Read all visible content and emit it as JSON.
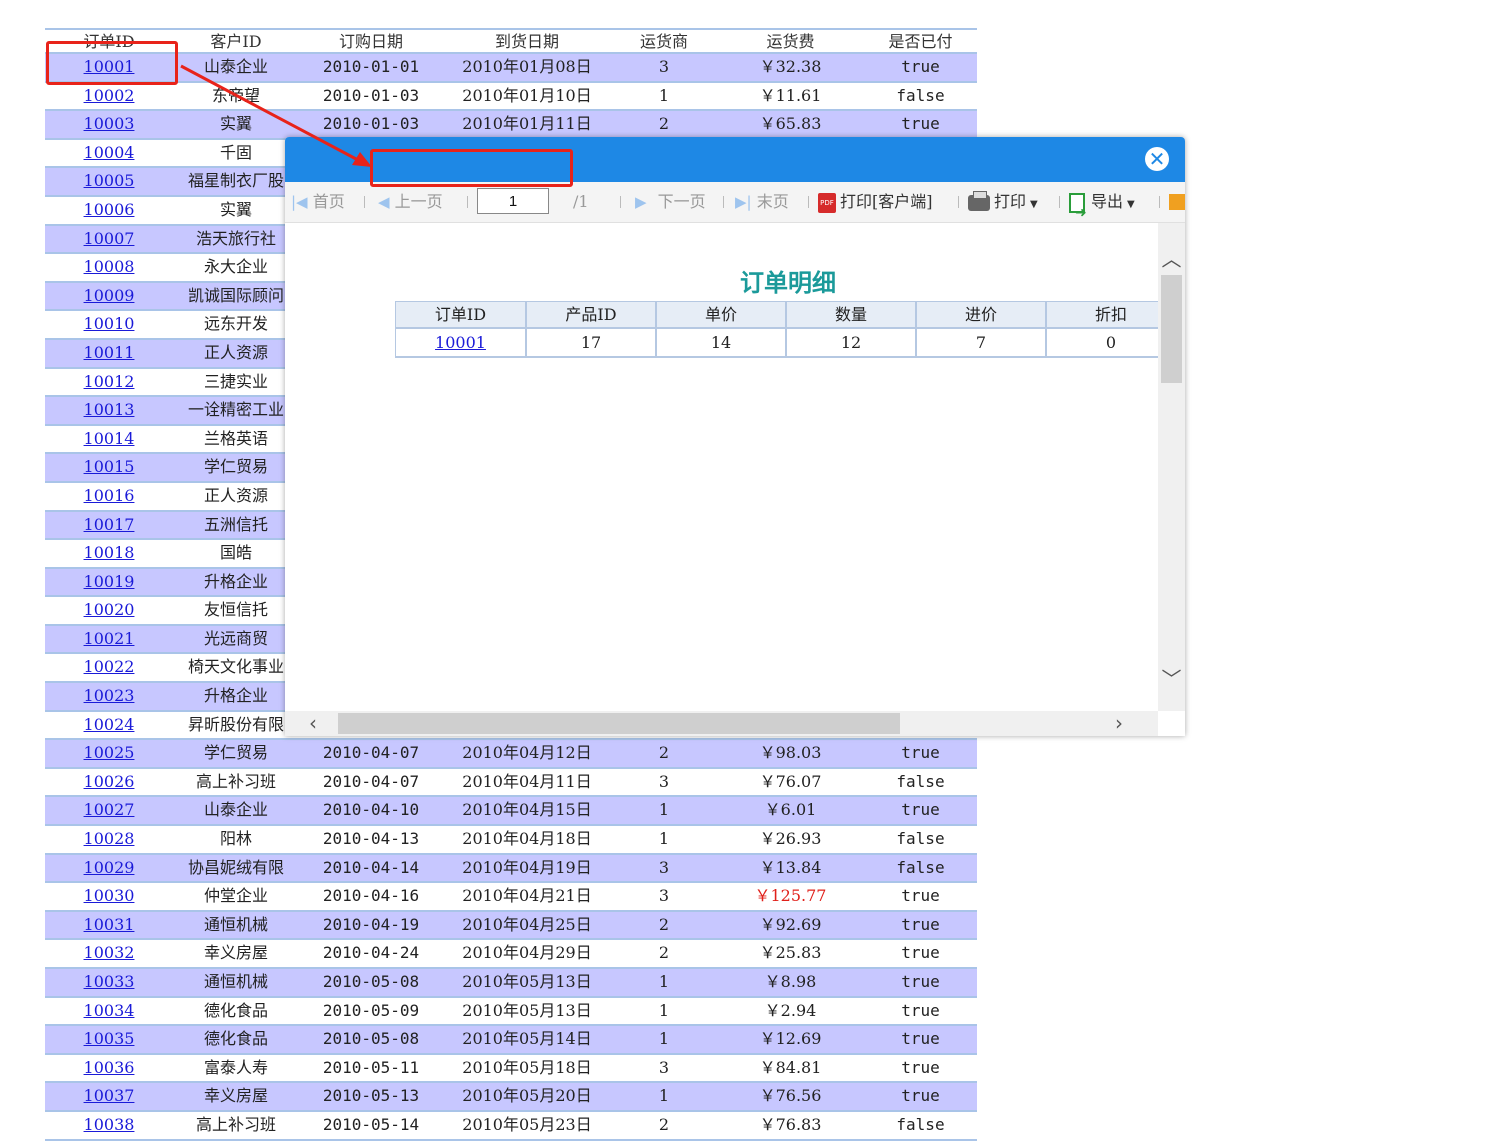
{
  "orders_table": {
    "headers": [
      "订单ID",
      "客户ID",
      "订购日期",
      "到货日期",
      "运货商",
      "运货费",
      "是否已付"
    ],
    "rows": [
      [
        "10001",
        "山泰企业",
        "2010-01-01",
        "2010年01月08日",
        "3",
        "￥32.38",
        "true"
      ],
      [
        "10002",
        "东帝望",
        "2010-01-03",
        "2010年01月10日",
        "1",
        "￥11.61",
        "false"
      ],
      [
        "10003",
        "实翼",
        "2010-01-03",
        "2010年01月11日",
        "2",
        "￥65.83",
        "true"
      ],
      [
        "10004",
        "千固",
        "",
        "",
        "",
        "",
        ""
      ],
      [
        "10005",
        "福星制衣厂股",
        "",
        "",
        "",
        "",
        ""
      ],
      [
        "10006",
        "实翼",
        "",
        "",
        "",
        "",
        ""
      ],
      [
        "10007",
        "浩天旅行社",
        "",
        "",
        "",
        "",
        ""
      ],
      [
        "10008",
        "永大企业",
        "",
        "",
        "",
        "",
        ""
      ],
      [
        "10009",
        "凯诚国际顾问",
        "",
        "",
        "",
        "",
        ""
      ],
      [
        "10010",
        "远东开发",
        "",
        "",
        "",
        "",
        ""
      ],
      [
        "10011",
        "正人资源",
        "",
        "",
        "",
        "",
        ""
      ],
      [
        "10012",
        "三捷实业",
        "",
        "",
        "",
        "",
        ""
      ],
      [
        "10013",
        "一诠精密工业",
        "",
        "",
        "",
        "",
        ""
      ],
      [
        "10014",
        "兰格英语",
        "",
        "",
        "",
        "",
        ""
      ],
      [
        "10015",
        "学仁贸易",
        "",
        "",
        "",
        "",
        ""
      ],
      [
        "10016",
        "正人资源",
        "",
        "",
        "",
        "",
        ""
      ],
      [
        "10017",
        "五洲信托",
        "",
        "",
        "",
        "",
        ""
      ],
      [
        "10018",
        "国皓",
        "",
        "",
        "",
        "",
        ""
      ],
      [
        "10019",
        "升格企业",
        "",
        "",
        "",
        "",
        ""
      ],
      [
        "10020",
        "友恒信托",
        "",
        "",
        "",
        "",
        ""
      ],
      [
        "10021",
        "光远商贸",
        "",
        "",
        "",
        "",
        ""
      ],
      [
        "10022",
        "椅天文化事业",
        "",
        "",
        "",
        "",
        ""
      ],
      [
        "10023",
        "升格企业",
        "",
        "",
        "",
        "",
        ""
      ],
      [
        "10024",
        "昇昕股份有限",
        "",
        "",
        "",
        "",
        ""
      ],
      [
        "10025",
        "学仁贸易",
        "2010-04-07",
        "2010年04月12日",
        "2",
        "￥98.03",
        "true"
      ],
      [
        "10026",
        "高上补习班",
        "2010-04-07",
        "2010年04月11日",
        "3",
        "￥76.07",
        "false"
      ],
      [
        "10027",
        "山泰企业",
        "2010-04-10",
        "2010年04月15日",
        "1",
        "￥6.01",
        "true"
      ],
      [
        "10028",
        "阳林",
        "2010-04-13",
        "2010年04月18日",
        "1",
        "￥26.93",
        "false"
      ],
      [
        "10029",
        "协昌妮绒有限",
        "2010-04-14",
        "2010年04月19日",
        "3",
        "￥13.84",
        "false"
      ],
      [
        "10030",
        "仲堂企业",
        "2010-04-16",
        "2010年04月21日",
        "3",
        "￥125.77",
        "true"
      ],
      [
        "10031",
        "通恒机械",
        "2010-04-19",
        "2010年04月25日",
        "2",
        "￥92.69",
        "true"
      ],
      [
        "10032",
        "幸义房屋",
        "2010-04-24",
        "2010年04月29日",
        "2",
        "￥25.83",
        "true"
      ],
      [
        "10033",
        "通恒机械",
        "2010-05-08",
        "2010年05月13日",
        "1",
        "￥8.98",
        "true"
      ],
      [
        "10034",
        "德化食品",
        "2010-05-09",
        "2010年05月13日",
        "1",
        "￥2.94",
        "true"
      ],
      [
        "10035",
        "德化食品",
        "2010-05-08",
        "2010年05月14日",
        "1",
        "￥12.69",
        "true"
      ],
      [
        "10036",
        "富泰人寿",
        "2010-05-11",
        "2010年05月18日",
        "3",
        "￥84.81",
        "true"
      ],
      [
        "10037",
        "幸义房屋",
        "2010-05-13",
        "2010年05月20日",
        "1",
        "￥76.56",
        "true"
      ],
      [
        "10038",
        "高上补习班",
        "2010-05-14",
        "2010年05月23日",
        "2",
        "￥76.83",
        "false"
      ]
    ],
    "highlight_fee": "￥125.77",
    "colors": {
      "odd_row": "#c7c7ff",
      "border": "#a9c4e8",
      "link": "#1a1ad8",
      "alert": "#e0201a"
    }
  },
  "modal": {
    "close_glyph": "✕",
    "toolbar": {
      "first": "首页",
      "prev": "上一页",
      "page_value": "1",
      "page_total": "/1",
      "next": "下一页",
      "last": "末页",
      "print_client": "打印[客户端]",
      "print": "打印",
      "export": "导出",
      "pdf_glyph": "PDF"
    },
    "report_title": "订单明细",
    "detail_headers": [
      "订单ID",
      "产品ID",
      "单价",
      "数量",
      "进价",
      "折扣"
    ],
    "detail_rows": [
      [
        "10001",
        "17",
        "14",
        "12",
        "7",
        "0"
      ]
    ],
    "colors": {
      "title_bar": "#1e88e5",
      "report_title": "#1b9a9a"
    }
  },
  "annotation_color": "#e8231a"
}
